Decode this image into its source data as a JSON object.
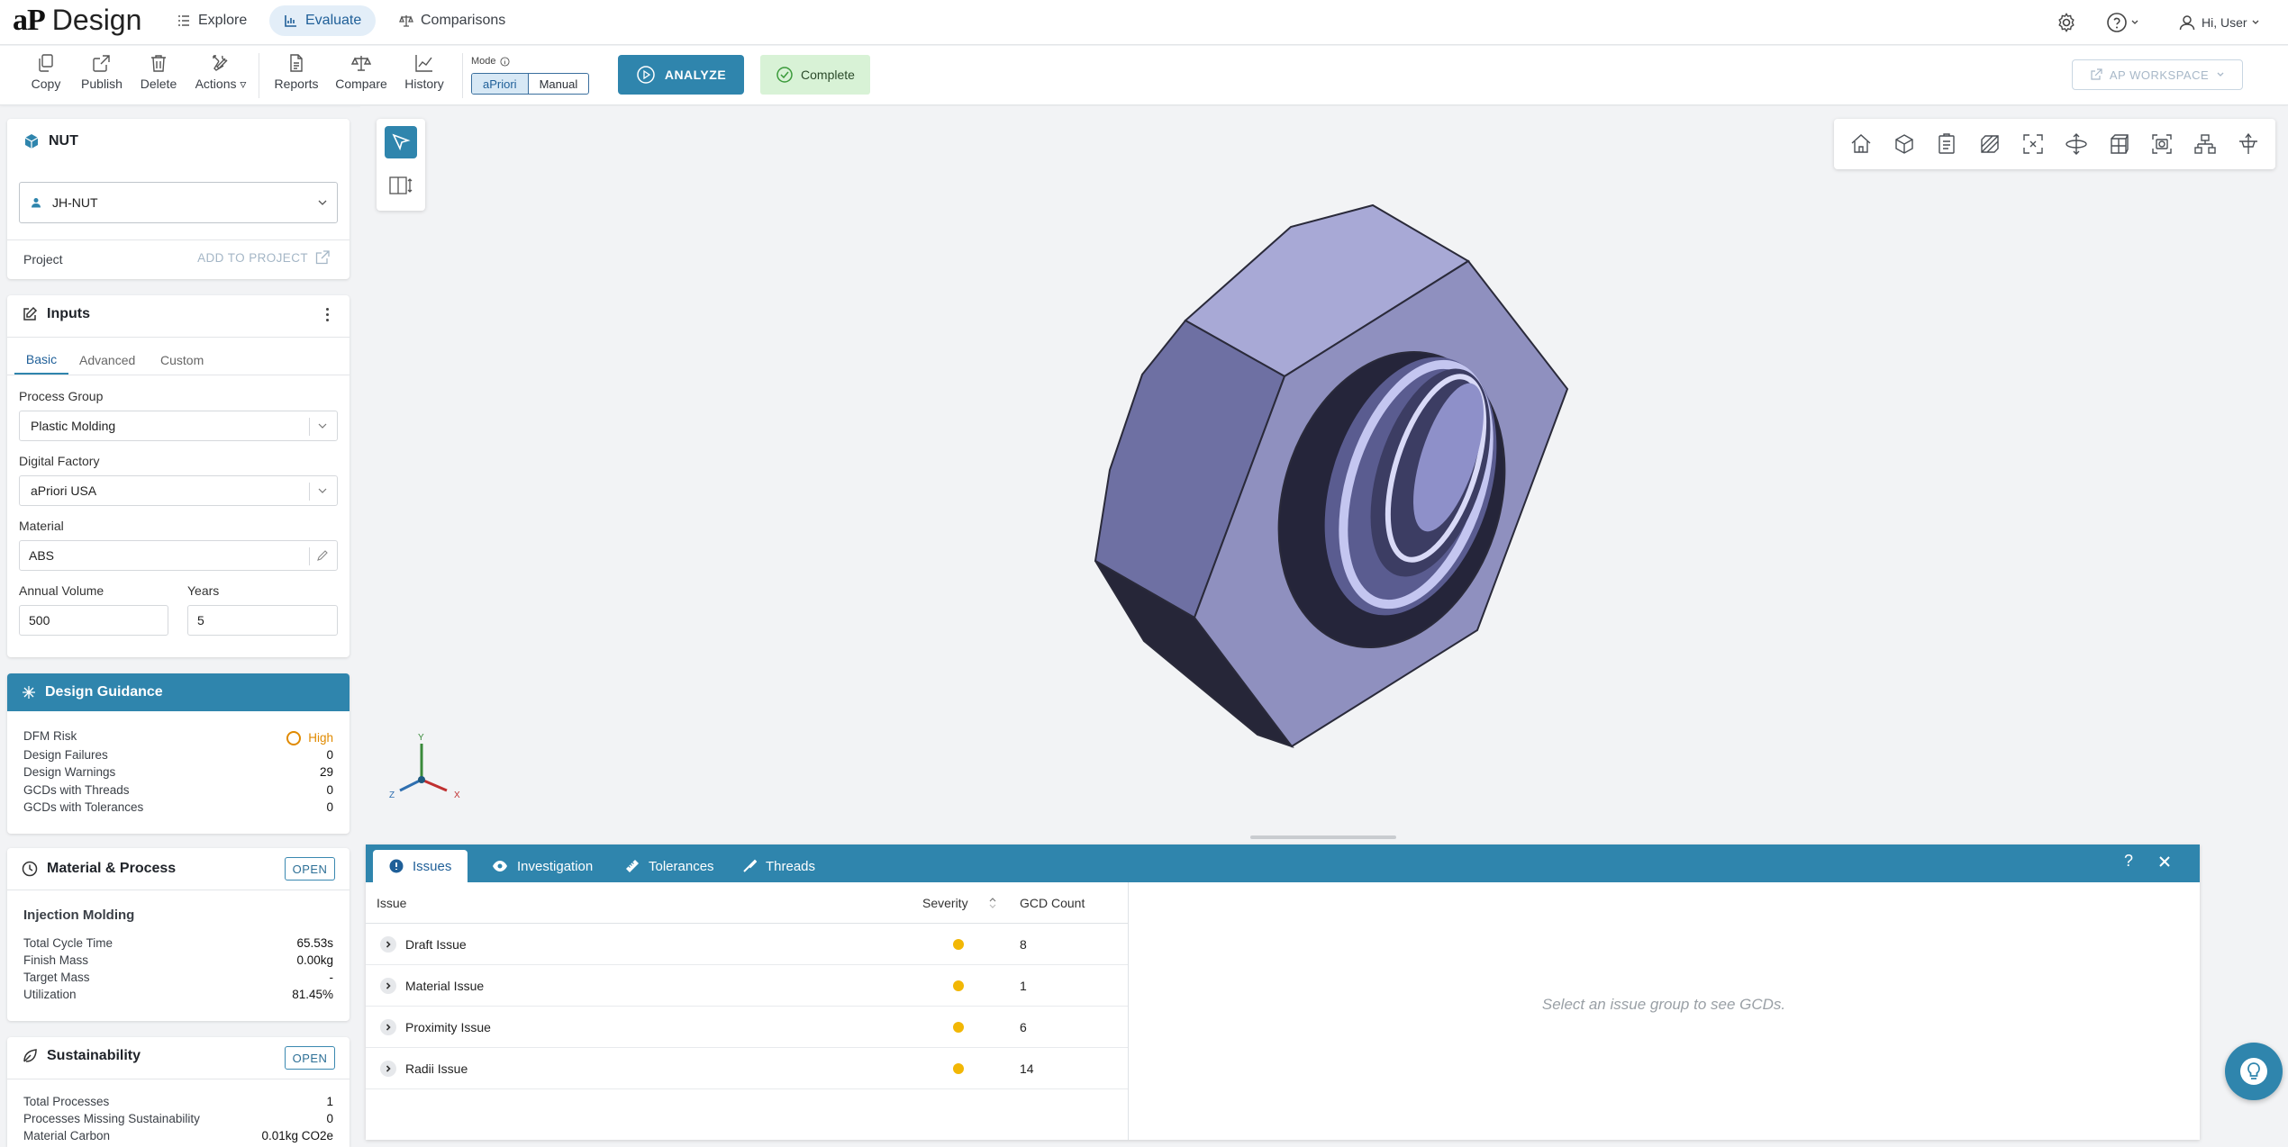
{
  "app": {
    "logo_text": "aP",
    "logo_suffix": "Design"
  },
  "nav": {
    "explore": "Explore",
    "evaluate": "Evaluate",
    "comparisons": "Comparisons",
    "user_greeting": "Hi, User"
  },
  "toolbar": {
    "copy": "Copy",
    "publish": "Publish",
    "delete": "Delete",
    "actions": "Actions",
    "reports": "Reports",
    "compare": "Compare",
    "history": "History",
    "mode_label": "Mode",
    "mode_apriori": "aPriori",
    "mode_manual": "Manual",
    "analyze": "ANALYZE",
    "status": "Complete",
    "workspace": "AP WORKSPACE"
  },
  "part": {
    "name": "NUT",
    "scenario": "JH-NUT",
    "project_label": "Project",
    "add_to_project": "ADD TO PROJECT"
  },
  "inputs": {
    "title": "Inputs",
    "tabs": [
      "Basic",
      "Advanced",
      "Custom"
    ],
    "process_group_label": "Process Group",
    "process_group": "Plastic Molding",
    "digital_factory_label": "Digital Factory",
    "digital_factory": "aPriori USA",
    "material_label": "Material",
    "material": "ABS",
    "annual_volume_label": "Annual Volume",
    "annual_volume": "500",
    "years_label": "Years",
    "years": "5"
  },
  "guidance": {
    "title": "Design Guidance",
    "rows": [
      {
        "label": "DFM Risk",
        "value": "High"
      },
      {
        "label": "Design Failures",
        "value": "0"
      },
      {
        "label": "Design Warnings",
        "value": "29"
      },
      {
        "label": "GCDs with Threads",
        "value": "0"
      },
      {
        "label": "GCDs with Tolerances",
        "value": "0"
      }
    ],
    "risk_color": "#e08a00"
  },
  "material_process": {
    "title": "Material & Process",
    "open": "OPEN",
    "process": "Injection Molding",
    "rows": [
      {
        "label": "Total Cycle Time",
        "value": "65.53s"
      },
      {
        "label": "Finish Mass",
        "value": "0.00kg"
      },
      {
        "label": "Target Mass",
        "value": "-"
      },
      {
        "label": "Utilization",
        "value": "81.45%"
      }
    ]
  },
  "sustainability": {
    "title": "Sustainability",
    "open": "OPEN",
    "rows": [
      {
        "label": "Total Processes",
        "value": "1"
      },
      {
        "label": "Processes Missing Sustainability",
        "value": "0"
      },
      {
        "label": "Material Carbon",
        "value": "0.01kg CO2e"
      }
    ]
  },
  "axes": {
    "x": "X",
    "y": "Y",
    "z": "Z"
  },
  "issues_panel": {
    "tabs": [
      "Issues",
      "Investigation",
      "Tolerances",
      "Threads"
    ],
    "help": "?",
    "col_issue": "Issue",
    "col_severity": "Severity",
    "col_gcd": "GCD Count",
    "rows": [
      {
        "issue": "Draft Issue",
        "gcd": "8"
      },
      {
        "issue": "Material Issue",
        "gcd": "1"
      },
      {
        "issue": "Proximity Issue",
        "gcd": "6"
      },
      {
        "issue": "Radii Issue",
        "gcd": "14"
      }
    ],
    "empty_message": "Select an issue group to see GCDs.",
    "severity_color": "#f2b705"
  },
  "colors": {
    "accent": "#2f85ad",
    "complete_bg": "#d8f2d6",
    "nut_face": "#8f90bf"
  }
}
